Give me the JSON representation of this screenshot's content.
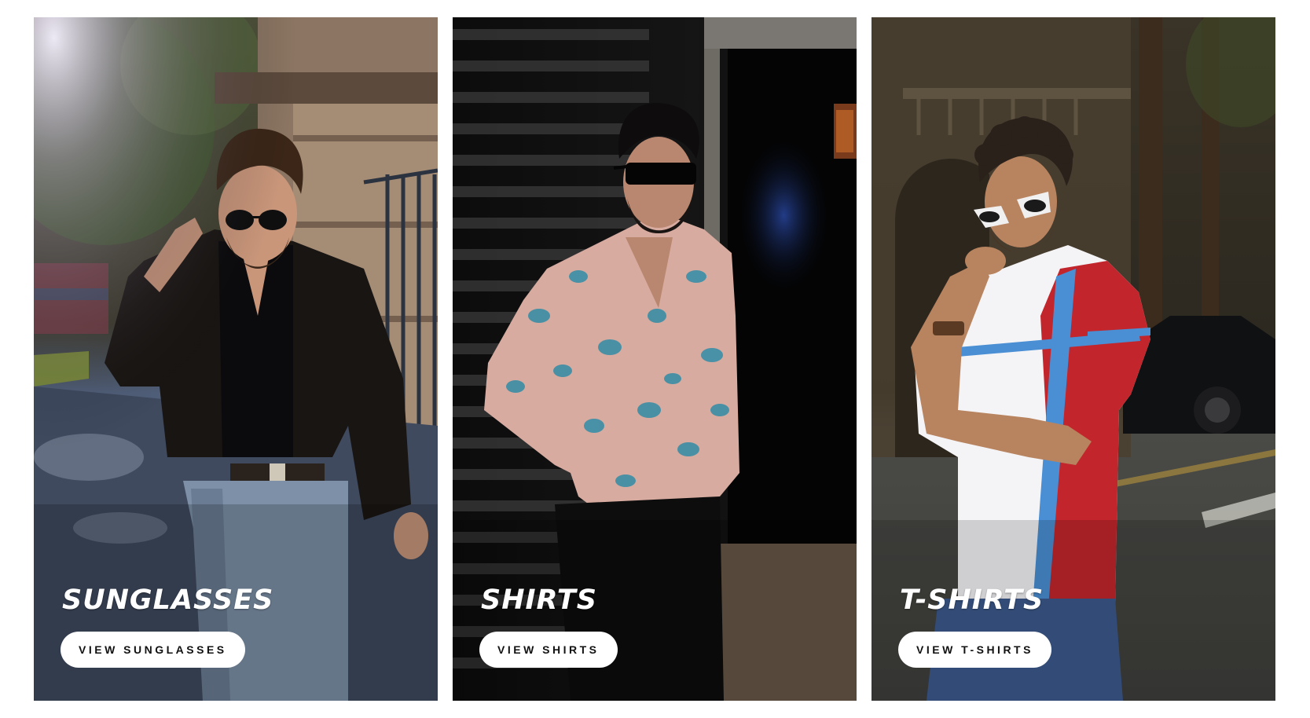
{
  "collections": [
    {
      "title": "SUNGLASSES",
      "button_label": "VIEW SUNGLASSES"
    },
    {
      "title": "SHIRTS",
      "button_label": "VIEW SHIRTS"
    },
    {
      "title": "T-SHIRTS",
      "button_label": "VIEW T-SHIRTS"
    }
  ],
  "colors": {
    "button_bg": "#ffffff",
    "button_text": "#111111",
    "title_text": "#ffffff"
  }
}
